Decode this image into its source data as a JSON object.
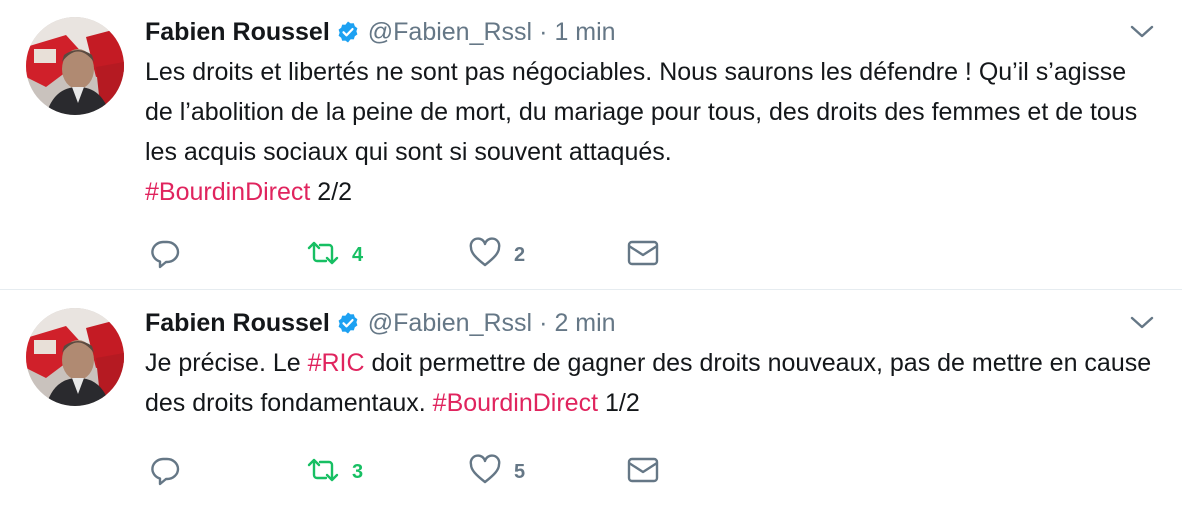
{
  "colors": {
    "hashtag": "#e0245e",
    "retweet_active": "#17bf63",
    "muted": "#657786",
    "verified": "#1da1f2",
    "text": "#14171a"
  },
  "icons": {
    "reply": "reply-bubble-icon",
    "retweet": "retweet-arrows-icon",
    "like": "heart-icon",
    "dm": "envelope-icon",
    "verified": "verified-badge-icon",
    "menu": "chevron-down-icon"
  },
  "tweets": [
    {
      "author": {
        "name": "Fabien Roussel",
        "handle": "@Fabien_Rssl",
        "verified": true
      },
      "separator": "·",
      "time": "1 min",
      "text": {
        "line1": "Les droits et libertés ne sont pas négociables. Nous saurons les défendre ! Qu’il s’agisse de l’abolition de la peine de mort, du mariage pour tous, des droits des femmes et de tous les acquis sociaux qui sont si souvent attaqués.",
        "hashtag": "#BourdinDirect",
        "suffix": " 2/2"
      },
      "actions": {
        "retweets": "4",
        "likes": "2"
      }
    },
    {
      "author": {
        "name": "Fabien Roussel",
        "handle": "@Fabien_Rssl",
        "verified": true
      },
      "separator": "·",
      "time": "2 min",
      "text": {
        "part1": "Je précise. Le ",
        "hashtag1": "#RIC",
        "part2": " doit permettre de gagner des droits nouveaux, pas de mettre en cause des droits fondamentaux. ",
        "hashtag2": "#BourdinDirect",
        "suffix": " 1/2"
      },
      "actions": {
        "retweets": "3",
        "likes": "5"
      }
    }
  ]
}
